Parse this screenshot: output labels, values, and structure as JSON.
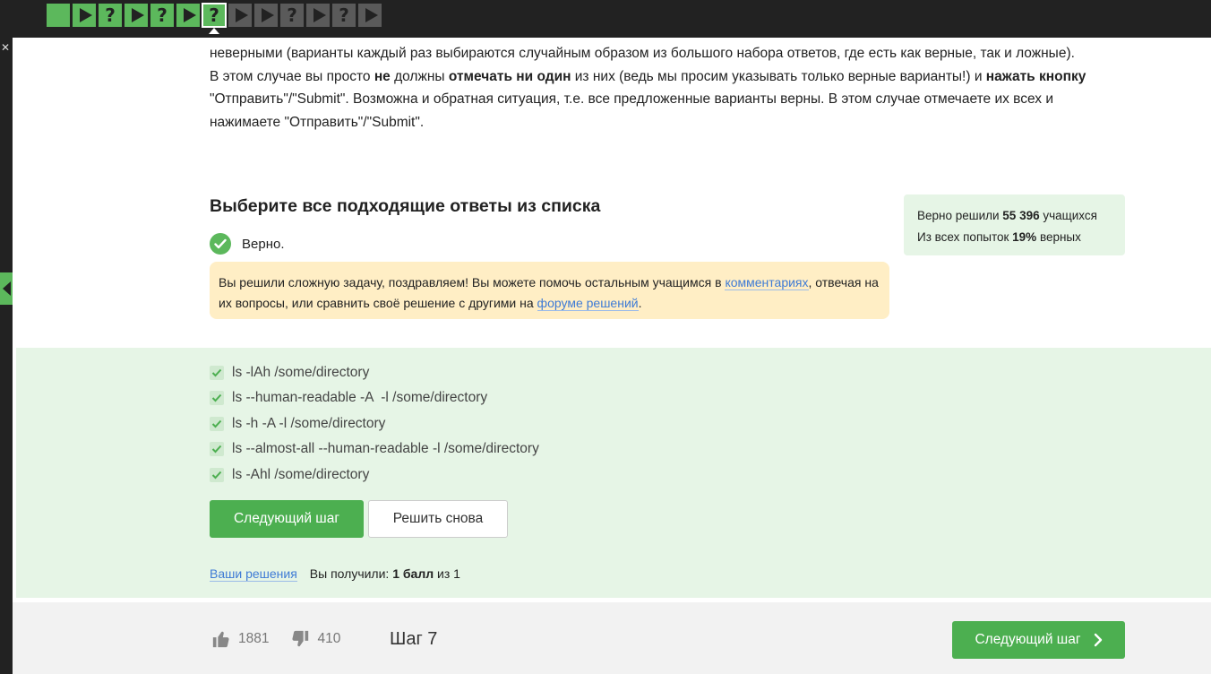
{
  "steps": [
    {
      "type": "done-text"
    },
    {
      "type": "done-play"
    },
    {
      "type": "done-quiz",
      "glyph": "?"
    },
    {
      "type": "done-play"
    },
    {
      "type": "done-quiz",
      "glyph": "?"
    },
    {
      "type": "done-play"
    },
    {
      "type": "current-quiz",
      "glyph": "?"
    },
    {
      "type": "todo-play"
    },
    {
      "type": "todo-play"
    },
    {
      "type": "todo-quiz",
      "glyph": "?"
    },
    {
      "type": "todo-play"
    },
    {
      "type": "todo-quiz",
      "glyph": "?"
    },
    {
      "type": "todo-play"
    }
  ],
  "instructions": {
    "line1": "неверными (варианты каждый раз выбираются случайным образом из большого набора ответов, где есть как верные, так и ложные).",
    "l2a": "В этом случае вы просто ",
    "l2b": "не",
    "l2c": " должны ",
    "l2d": "отмечать ни один",
    "l2e": " из них (ведь мы просим указывать только верные варианты!) и ",
    "l2f": "нажать кнопку",
    "line3": "\"Отправить\"/\"Submit\". Возможна и обратная ситуация, т.е. все предложенные варианты верны. В этом случае отмечаете их всех и",
    "line4": "нажимаете \"Отправить\"/\"Submit\"."
  },
  "question": {
    "title": "Выберите все подходящие ответы из списка",
    "status": "Верно."
  },
  "notice": {
    "t1": "Вы решили сложную задачу, поздравляем! Вы можете помочь остальным учащимся в ",
    "link1": "комментариях",
    "t2": ", отвечая на их вопросы, или сравнить своё решение с другими на ",
    "link2": "форуме решений",
    "t3": "."
  },
  "stats": {
    "solved_prefix": "Верно решили ",
    "solved_count": "55 396",
    "solved_suffix": " учащихся",
    "attempts_prefix": "Из всех попыток ",
    "attempts_pct": "19%",
    "attempts_suffix": " верных"
  },
  "options": [
    {
      "label": "ls -lAh /some/directory",
      "checked": true
    },
    {
      "label": "ls --human-readable -A  -l /some/directory",
      "checked": true
    },
    {
      "label": "ls -h -A -l /some/directory",
      "checked": true
    },
    {
      "label": "ls --almost-all --human-readable -l /some/directory",
      "checked": true
    },
    {
      "label": "ls -Ahl /some/directory",
      "checked": true
    }
  ],
  "buttons": {
    "next": "Следующий шаг",
    "retry": "Решить снова"
  },
  "result": {
    "link": "Ваши решения",
    "prefix": "Вы получили: ",
    "score": "1 балл",
    "suffix": " из 1"
  },
  "footer": {
    "likes": "1881",
    "dislikes": "410",
    "step": "Шаг 7",
    "next": "Следующий шаг"
  },
  "colors": {
    "accent": "#4caf50",
    "done_step": "#5cb85c",
    "todo_step": "#5a5a5a",
    "success_bg": "#e6f5e6",
    "notice_bg": "#ffeec5",
    "link": "#3f7bd5"
  }
}
